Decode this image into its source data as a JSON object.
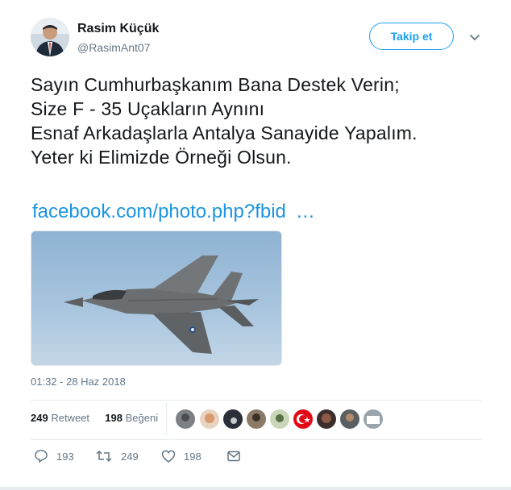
{
  "author": {
    "name": "Rasim Küçük",
    "handle": "@RasimAnt07"
  },
  "follow_button": {
    "label": "Takip et"
  },
  "tweet": {
    "lines": [
      "Sayın Cumhurbaşkanım Bana Destek Verin;",
      "Size F - 35 Uçakların Aynını",
      "Esnaf Arkadaşlarla Antalya Sanayide Yapalım.",
      "Yeter ki Elimizde Örneği Olsun."
    ],
    "link_text": "facebook.com/photo.php?fbid",
    "link_ellipsis": "…",
    "timestamp": "01:32 - 28 Haz 2018"
  },
  "stats": {
    "retweets": "249",
    "retweets_label": "Retweet",
    "likes": "198",
    "likes_label": "Beğeni"
  },
  "actions": {
    "replies": "193",
    "retweets": "249",
    "likes": "198"
  },
  "colors": {
    "accent": "#1da1f2",
    "link": "#1b95e0",
    "muted": "#657786",
    "text": "#14171a"
  },
  "icons": [
    "reply-icon",
    "retweet-icon",
    "like-icon",
    "message-icon",
    "chevron-down-icon"
  ]
}
